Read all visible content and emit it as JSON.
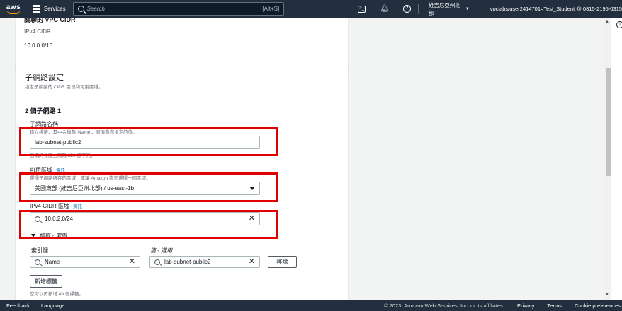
{
  "topnav": {
    "logo": "aws",
    "services": "Services",
    "search_placeholder": "Search",
    "search_shortcut": "[Alt+S]",
    "region": "維吉尼亞州北部",
    "account": "voclabs/user2414701=Test_Student @ 0815-2195-0315"
  },
  "vpc_card": {
    "heading": "關聯的 VPC CIDR",
    "label": "IPv4 CIDR",
    "value": "10.0.0.0/16"
  },
  "subnet_settings": {
    "title": "子網路設定",
    "subtitle": "指定子網路的 CIDR 區塊和可用區域。",
    "section": "2 個子網路 1",
    "name_label": "子網路名稱",
    "name_desc": "建立標籤，其中金鑰為 'Name'，而值為您指定的值。",
    "name_value": "lab-subnet-public2",
    "name_hint": "名稱的長度上限為 256 個字元。",
    "az_label": "可用區域",
    "az_info": "資訊",
    "az_desc": "選擇子網路所在的區域，或讓 Amazon 為您選擇一個區域。",
    "az_value": "美國東部 (維吉尼亞州北部) / us-east-1b",
    "cidr_label": "IPv4 CIDR 區塊",
    "cidr_info": "資訊",
    "cidr_value": "10.0.2.0/24",
    "tags_toggle": "標籤 - 選用",
    "key_label": "索引鍵",
    "value_label": "值 - 選用",
    "key_value": "Name",
    "tag_value": "lab-subnet-public2",
    "remove_button": "移除",
    "add_tag_button": "新增標籤",
    "tags_remaining": "您可以再新增 49 個標籤。"
  },
  "footer": {
    "feedback": "Feedback",
    "language": "Language",
    "copyright": "© 2023, Amazon Web Services, Inc. or its affiliates.",
    "privacy": "Privacy",
    "terms": "Terms",
    "cookie": "Cookie preferences"
  },
  "colors": {
    "nav_bg": "#232f3e",
    "highlight": "#e00000",
    "link": "#0073bb",
    "accent": "#ff9900"
  }
}
